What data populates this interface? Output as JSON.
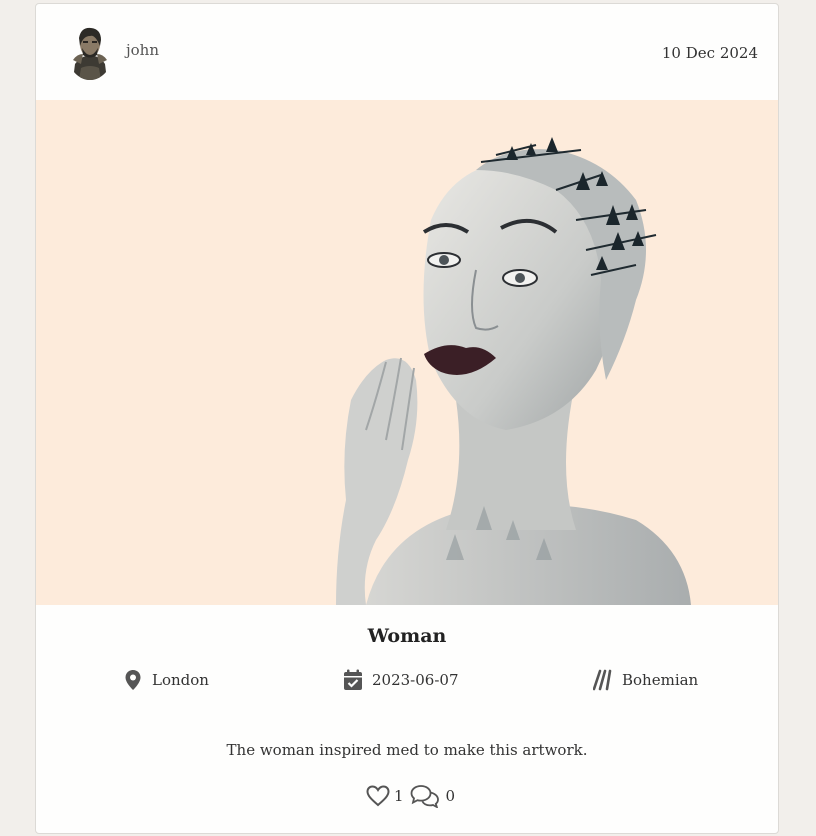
{
  "post": {
    "author": "john",
    "date": "10 Dec 2024",
    "title": "Woman",
    "location": "London",
    "created": "2023-06-07",
    "style": "Bohemian",
    "description": "The woman inspired med to make this artwork.",
    "likes": "1",
    "comments": "0"
  },
  "icons": {
    "location": "map-pin-icon",
    "date": "calendar-check-icon",
    "style": "brush-strokes-icon",
    "like": "heart-outline-icon",
    "comment": "speech-bubbles-icon"
  },
  "colors": {
    "page_background": "#f2efeb",
    "card_background": "#fefefd",
    "image_background": "#fdebdb",
    "icon": "#555555",
    "text": "#333333"
  }
}
